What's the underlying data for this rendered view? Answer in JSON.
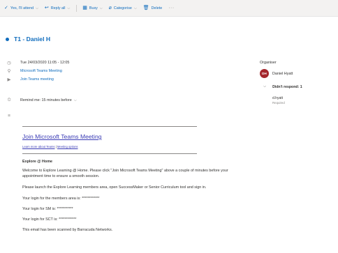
{
  "toolbar": {
    "attend_label": "Yes, I'll attend",
    "reply_label": "Reply all",
    "busy_label": "Busy",
    "categorise_label": "Categorise",
    "delete_label": "Delete",
    "more_label": "···"
  },
  "event": {
    "title": "T1 - Daniel H",
    "datetime": "Tue 24/03/2020 11:05 - 12:05",
    "location": "Microsoft Teams Meeting",
    "join_link": "Join Teams meeting",
    "reminder": "Remind me: 15 minutes before"
  },
  "organiser": {
    "heading": "Organiser",
    "initials": "DH",
    "name": "Daniel Hyatt",
    "avatar_color": "#a4262c"
  },
  "attendees": {
    "group_label": "Didn't respond: 1",
    "items": [
      {
        "name": "d.hyatt",
        "role": "Required"
      }
    ]
  },
  "body": {
    "join_link": "Join Microsoft Teams Meeting",
    "learn_more": "Learn more about Teams",
    "separator": "|",
    "meeting_options": "Meeting options",
    "heading": "Explore @ Home",
    "p1": "Welcome to Explore Learning @ Home. Please click \"Join Microsoft Teams Meeting\" above a couple of minutes before your appointment time to ensure a smooth session.",
    "p2": "Please launch the Explore Learning members area, open SuccessMaker or Senior Curriculum tool and sign in.",
    "p3": "Your login for the members area is: ************",
    "p4": "Your login for SM is: ***********",
    "p5": "Your login for SCT is: ************",
    "p6": "This email has been scanned by Barracuda Networks."
  },
  "colors": {
    "accent": "#0f6cbd",
    "link": "#3a3bb5",
    "toolbar_bg": "#f3f2f1"
  },
  "icons": [
    "check-icon",
    "reply-all-icon",
    "busy-calendar-icon",
    "tag-icon",
    "trash-icon",
    "clock-icon",
    "location-pin-icon",
    "teams-video-icon",
    "reminder-icon",
    "notes-icon",
    "chevron-down-icon"
  ]
}
